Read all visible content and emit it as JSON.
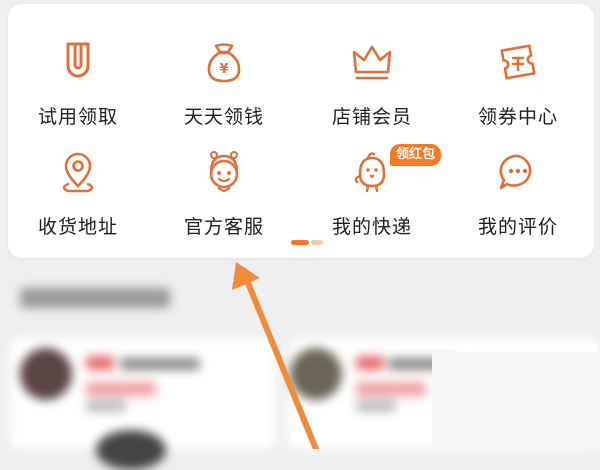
{
  "menu": {
    "items": [
      {
        "label": "试用领取",
        "icon": "trial-u-icon"
      },
      {
        "label": "天天领钱",
        "icon": "money-bag-icon"
      },
      {
        "label": "店铺会员",
        "icon": "crown-icon"
      },
      {
        "label": "领券中心",
        "icon": "coupon-icon"
      },
      {
        "label": "收货地址",
        "icon": "location-pin-icon"
      },
      {
        "label": "官方客服",
        "icon": "customer-service-icon"
      },
      {
        "label": "我的快递",
        "icon": "courier-bird-icon"
      },
      {
        "label": "我的评价",
        "icon": "chat-bubble-icon"
      }
    ],
    "badge": "领红包"
  },
  "pager": {
    "active_page": 1
  },
  "colors": {
    "accent": "#e0703a",
    "badge": "#f47a27",
    "pointer": "#f08a3c"
  }
}
